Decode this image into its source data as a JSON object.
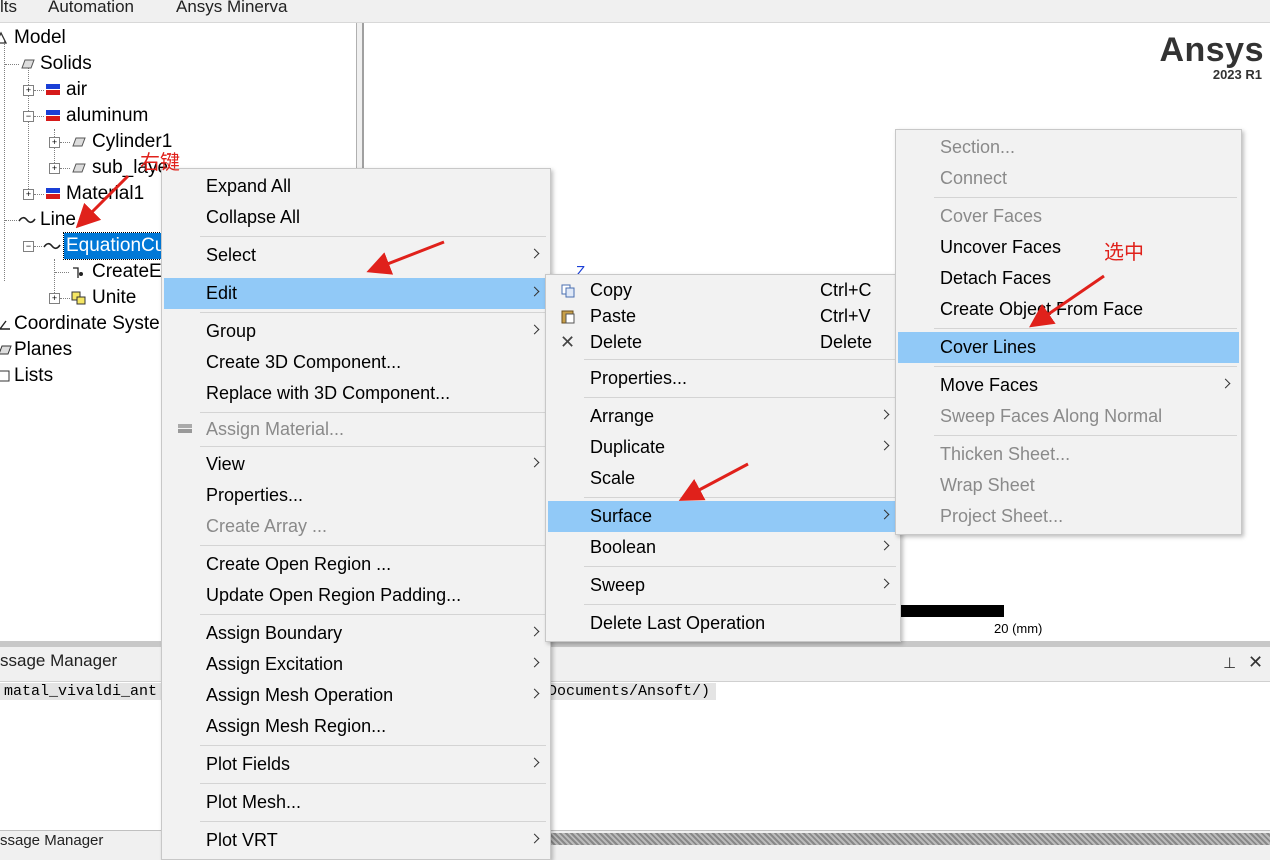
{
  "menubar": {
    "items": [
      "lts",
      "Automation",
      "Ansys Minerva"
    ]
  },
  "tree": {
    "nodes": [
      {
        "label": "Model"
      },
      {
        "label": "Solids"
      },
      {
        "label": "air"
      },
      {
        "label": "aluminum"
      },
      {
        "label": "Cylinder1"
      },
      {
        "label": "sub_laye"
      },
      {
        "label": "Material1"
      },
      {
        "label": "Line"
      },
      {
        "label": "EquationCu"
      },
      {
        "label": "CreateEq"
      },
      {
        "label": "Unite"
      },
      {
        "label": "Coordinate Syste"
      },
      {
        "label": "Planes"
      },
      {
        "label": "Lists"
      }
    ]
  },
  "viewport": {
    "logo": "Ansys",
    "version": "2023 R1",
    "axis_label": "Z",
    "scale_label": "20 (mm)"
  },
  "message_manager": {
    "title": "ssage Manager",
    "line_left": "matal_vivaldi_ant",
    "line_right": "Documents/Ansoft/)",
    "bottom_title": "ssage Manager"
  },
  "context_menu": {
    "items": [
      {
        "label": "Expand All"
      },
      {
        "label": "Collapse All"
      },
      {
        "label": "Select"
      },
      {
        "label": "Edit"
      },
      {
        "label": "Group"
      },
      {
        "label": "Create 3D Component..."
      },
      {
        "label": "Replace with 3D Component..."
      },
      {
        "label": "Assign Material..."
      },
      {
        "label": "View"
      },
      {
        "label": "Properties..."
      },
      {
        "label": "Create Array ..."
      },
      {
        "label": "Create Open Region ..."
      },
      {
        "label": "Update Open Region Padding..."
      },
      {
        "label": "Assign Boundary"
      },
      {
        "label": "Assign Excitation"
      },
      {
        "label": "Assign Mesh Operation"
      },
      {
        "label": "Assign Mesh Region..."
      },
      {
        "label": "Plot Fields"
      },
      {
        "label": "Plot Mesh..."
      },
      {
        "label": "Plot VRT"
      }
    ]
  },
  "edit_menu": {
    "items": [
      {
        "label": "Copy",
        "shortcut": "Ctrl+C"
      },
      {
        "label": "Paste",
        "shortcut": "Ctrl+V"
      },
      {
        "label": "Delete",
        "shortcut": "Delete"
      },
      {
        "label": "Properties..."
      },
      {
        "label": "Arrange"
      },
      {
        "label": "Duplicate"
      },
      {
        "label": "Scale"
      },
      {
        "label": "Surface"
      },
      {
        "label": "Boolean"
      },
      {
        "label": "Sweep"
      },
      {
        "label": "Delete Last Operation"
      }
    ]
  },
  "surface_menu": {
    "items": [
      {
        "label": "Section..."
      },
      {
        "label": "Connect"
      },
      {
        "label": "Cover Faces"
      },
      {
        "label": "Uncover Faces"
      },
      {
        "label": "Detach Faces"
      },
      {
        "label": "Create Object From Face"
      },
      {
        "label": "Cover Lines"
      },
      {
        "label": "Move Faces"
      },
      {
        "label": "Sweep Faces Along Normal"
      },
      {
        "label": "Thicken Sheet..."
      },
      {
        "label": "Wrap Sheet"
      },
      {
        "label": "Project Sheet..."
      }
    ]
  },
  "annotations": {
    "right_click": "右键",
    "select": "选中"
  },
  "colors": {
    "highlight": "#91c9f7",
    "tree_selection": "#0078d7",
    "annotation": "#e0211b"
  }
}
